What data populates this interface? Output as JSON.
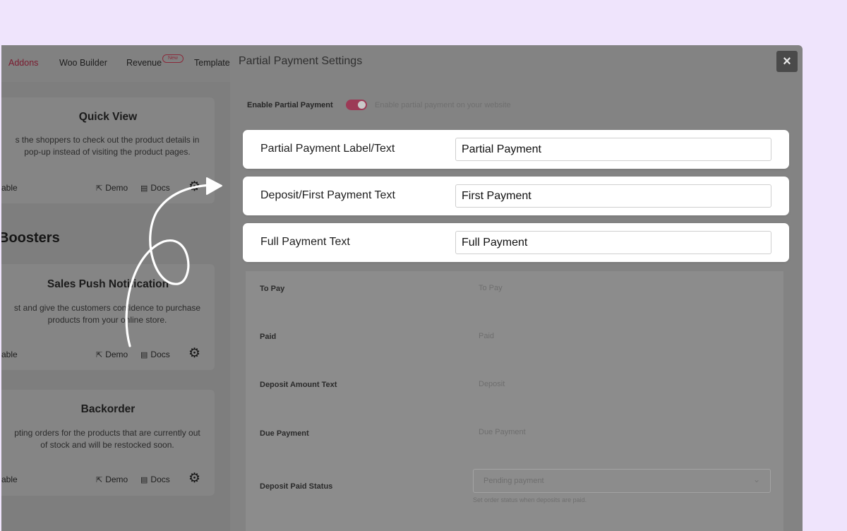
{
  "nav": {
    "items": [
      {
        "label": "Addons",
        "active": true
      },
      {
        "label": "Woo Builder",
        "active": false
      },
      {
        "label": "Revenue",
        "active": false,
        "badge": "New"
      },
      {
        "label": "Template",
        "active": false
      }
    ]
  },
  "cards": [
    {
      "title": "Quick View",
      "desc_lines": [
        "s the shoppers to check out the product details in",
        "pop-up instead of visiting the product pages."
      ],
      "enable_label": "able",
      "demo_label": "Demo",
      "docs_label": "Docs"
    },
    {
      "title": "Sales Push Notification",
      "desc_lines": [
        "st and give the customers confidence to purchase",
        "products from your online store."
      ],
      "enable_label": "able",
      "demo_label": "Demo",
      "docs_label": "Docs"
    },
    {
      "title": "Backorder",
      "desc_lines": [
        "pting orders for the products that are currently out",
        "of stock and will be restocked soon."
      ],
      "enable_label": "able",
      "demo_label": "Demo",
      "docs_label": "Docs"
    }
  ],
  "section_heading": "Boosters",
  "modal": {
    "title": "Partial Payment Settings",
    "close_symbol": "×",
    "enable": {
      "label": "Enable Partial Payment",
      "hint": "Enable partial payment on your website",
      "on": true
    },
    "highlighted_fields": [
      {
        "label": "Partial Payment Label/Text",
        "value": "Partial Payment"
      },
      {
        "label": "Deposit/First Payment Text",
        "value": "First Payment"
      },
      {
        "label": "Full Payment Text",
        "value": "Full Payment"
      }
    ],
    "dim_fields": [
      {
        "label": "To Pay",
        "value": "To Pay"
      },
      {
        "label": "Paid",
        "value": "Paid"
      },
      {
        "label": "Deposit Amount Text",
        "value": "Deposit"
      },
      {
        "label": "Due Payment",
        "value": "Due Payment"
      }
    ],
    "status_field": {
      "label": "Deposit Paid Status",
      "selected": "Pending payment",
      "help": "Set order status when deposits are paid."
    }
  },
  "colors": {
    "page_bg": "#efe4fc",
    "toggle_on": "#9c3a56",
    "nav_active": "#7a1a2e",
    "highlight_card": "#ffffff"
  }
}
